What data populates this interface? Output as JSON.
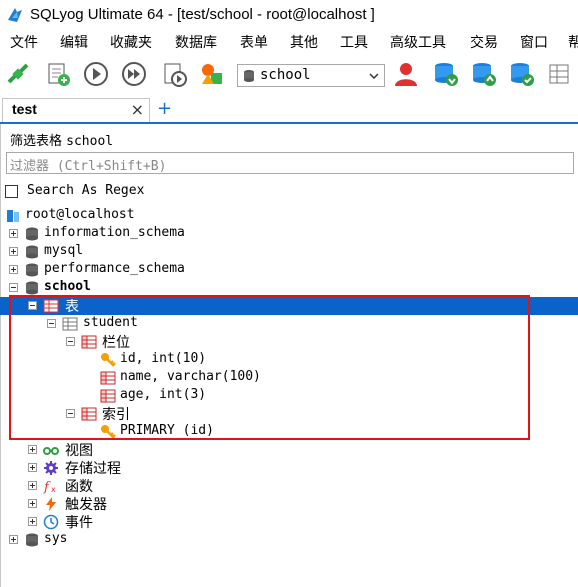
{
  "window": {
    "title": "SQLyog Ultimate 64 - [test/school - root@localhost ]"
  },
  "menu": [
    "文件",
    "编辑",
    "收藏夹",
    "数据库",
    "表单",
    "其他",
    "工具",
    "高级工具",
    "交易",
    "窗口",
    "帮"
  ],
  "toolbar": {
    "database_selected": "school"
  },
  "tabs": [
    {
      "label": "test",
      "close": "×"
    }
  ],
  "tab_add": "+",
  "filter": {
    "label": "筛选表格",
    "db": "school",
    "placeholder": "过滤器 (Ctrl+Shift+B)",
    "regex_label": "Search As Regex"
  },
  "tree": {
    "connection": "root@localhost",
    "databases": [
      "information_schema",
      "mysql",
      "performance_schema"
    ],
    "school": {
      "name": "school",
      "tables_folder": "表",
      "table": "student",
      "columns_folder": "栏位",
      "columns": [
        "id, int(10)",
        "name, varchar(100)",
        "age, int(3)"
      ],
      "index_folder": "索引",
      "index": "PRIMARY (id)",
      "views": "视图",
      "procs": "存储过程",
      "funcs": "函数",
      "triggers": "触发器",
      "events": "事件"
    },
    "sys": "sys"
  },
  "colors": {
    "selection": "#0a63c9",
    "highlight_box": "#e01414",
    "tab_underline": "#1a6fc9"
  }
}
